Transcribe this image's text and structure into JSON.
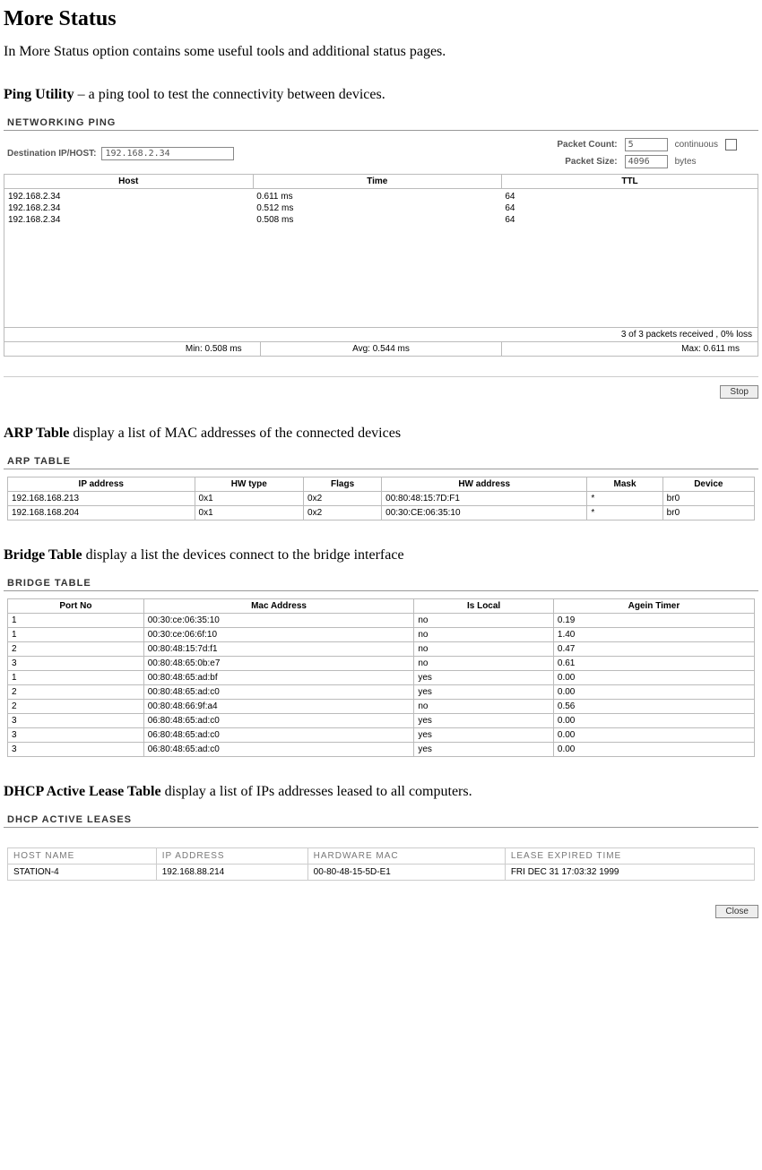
{
  "page": {
    "title": "More Status",
    "intro": "In More Status option contains some useful tools and additional status pages."
  },
  "ping_section": {
    "heading_bold": "Ping Utility",
    "heading_rest": " – a ping tool to test the connectivity between devices.",
    "panel_title": "NETWORKING PING",
    "dest_label": "Destination IP/HOST:",
    "dest_value": "192.168.2.34",
    "packet_count_label": "Packet Count:",
    "packet_count_value": "5",
    "continuous_label": "continuous",
    "packet_size_label": "Packet Size:",
    "packet_size_value": "4096",
    "bytes_label": "bytes",
    "cols": {
      "host": "Host",
      "time": "Time",
      "ttl": "TTL"
    },
    "rows": [
      {
        "host": "192.168.2.34",
        "time": "0.611 ms",
        "ttl": "64"
      },
      {
        "host": "192.168.2.34",
        "time": "0.512 ms",
        "ttl": "64"
      },
      {
        "host": "192.168.2.34",
        "time": "0.508 ms",
        "ttl": "64"
      }
    ],
    "summary": "3 of 3 packets received , 0% loss",
    "min": "Min: 0.508 ms",
    "avg": "Avg: 0.544 ms",
    "max": "Max: 0.611 ms",
    "stop_button": "Stop"
  },
  "arp_section": {
    "heading_bold": "ARP Table",
    "heading_rest": " display a list of MAC addresses of the connected devices",
    "panel_title": "ARP TABLE",
    "cols": [
      "IP address",
      "HW type",
      "Flags",
      "HW address",
      "Mask",
      "Device"
    ],
    "rows": [
      [
        "192.168.168.213",
        "0x1",
        "0x2",
        "00:80:48:15:7D:F1",
        "*",
        "br0"
      ],
      [
        "192.168.168.204",
        "0x1",
        "0x2",
        "00:30:CE:06:35:10",
        "*",
        "br0"
      ]
    ]
  },
  "bridge_section": {
    "heading_bold": "Bridge Table",
    "heading_rest": " display a list the devices connect to the bridge interface",
    "panel_title": "BRIDGE TABLE",
    "cols": [
      "Port No",
      "Mac Address",
      "Is Local",
      "Agein Timer"
    ],
    "rows": [
      [
        "1",
        "00:30:ce:06:35:10",
        "no",
        "0.19"
      ],
      [
        "1",
        "00:30:ce:06:6f:10",
        "no",
        "1.40"
      ],
      [
        "2",
        "00:80:48:15:7d:f1",
        "no",
        "0.47"
      ],
      [
        "3",
        "00:80:48:65:0b:e7",
        "no",
        "0.61"
      ],
      [
        "1",
        "00:80:48:65:ad:bf",
        "yes",
        "0.00"
      ],
      [
        "2",
        "00:80:48:65:ad:c0",
        "yes",
        "0.00"
      ],
      [
        "2",
        "00:80:48:66:9f:a4",
        "no",
        "0.56"
      ],
      [
        "3",
        "06:80:48:65:ad:c0",
        "yes",
        "0.00"
      ],
      [
        "3",
        "06:80:48:65:ad:c0",
        "yes",
        "0.00"
      ],
      [
        "3",
        "06:80:48:65:ad:c0",
        "yes",
        "0.00"
      ]
    ]
  },
  "dhcp_section": {
    "heading_bold": "DHCP Active Lease Table",
    "heading_rest": " display a list of IPs addresses leased to all computers.",
    "panel_title": "DHCP ACTIVE LEASES",
    "cols": [
      "HOST NAME",
      "IP ADDRESS",
      "HARDWARE MAC",
      "LEASE EXPIRED TIME"
    ],
    "rows": [
      [
        "STATION-4",
        "192.168.88.214",
        "00-80-48-15-5D-E1",
        "FRI DEC 31 17:03:32 1999"
      ]
    ],
    "close_button": "Close"
  }
}
